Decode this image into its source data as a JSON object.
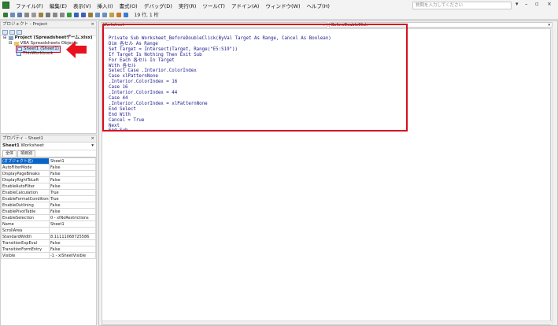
{
  "menu": {
    "items": [
      "ファイル(F)",
      "編集(E)",
      "表示(V)",
      "挿入(I)",
      "書式(O)",
      "デバッグ(D)",
      "実行(R)",
      "ツール(T)",
      "アドイン(A)",
      "ウィンドウ(W)",
      "ヘルプ(H)"
    ],
    "help_placeholder": "質問を入力してください",
    "close_glyph": "×"
  },
  "toolbar": {
    "position": "19 行, 1 桁"
  },
  "project_pane": {
    "title": "プロジェクト - Project",
    "tree": {
      "root": "Project (Spreadsheetゲーム.xlsx)",
      "folder": "VBA Spreadsheets Objects",
      "items": [
        "Sheet1 (Sheet1)",
        "ThisWorkbook"
      ]
    }
  },
  "properties_pane": {
    "title": "プロパティ - Sheet1",
    "object_name": "Sheet1",
    "object_type": "Worksheet",
    "tabs": [
      "全体",
      "項目別"
    ],
    "rows": [
      {
        "key": "(オブジェクト名)",
        "value": "Sheet1"
      },
      {
        "key": "AutoFilterMode",
        "value": "False"
      },
      {
        "key": "DisplayPageBreaks",
        "value": "False"
      },
      {
        "key": "DisplayRightToLeft",
        "value": "False"
      },
      {
        "key": "EnableAutoFilter",
        "value": "False"
      },
      {
        "key": "EnableCalculation",
        "value": "True"
      },
      {
        "key": "EnableFormatConditionsCalculation",
        "value": "True"
      },
      {
        "key": "EnableOutlining",
        "value": "False"
      },
      {
        "key": "EnablePivotTable",
        "value": "False"
      },
      {
        "key": "EnableSelection",
        "value": "0 - xlNoRestrictions"
      },
      {
        "key": "Name",
        "value": "Sheet1"
      },
      {
        "key": "ScrollArea",
        "value": ""
      },
      {
        "key": "StandardWidth",
        "value": "8.11111068725586"
      },
      {
        "key": "TransitionExpEval",
        "value": "False"
      },
      {
        "key": "TransitionFormEntry",
        "value": "False"
      },
      {
        "key": "Visible",
        "value": "-1 - xlSheetVisible"
      }
    ]
  },
  "code_window": {
    "object_combo": "Worksheet",
    "proc_combo": "BeforeDoubleClick",
    "lines": [
      "Private Sub Worksheet_BeforeDoubleClick(ByVal Target As Range, Cancel As Boolean)",
      "Dim 各セル As Range",
      "Set Target = Intersect(Target, Range(\"E5:S19\"))",
      "If Target Is Nothing Then Exit Sub",
      "For Each 各セル In Target",
      "With 各セル",
      "Select Case .Interior.ColorIndex",
      "Case xlPatternNone",
      ".Interior.ColorIndex = 16",
      "Case 16",
      ".Interior.ColorIndex = 44",
      "Case 44",
      ".Interior.ColorIndex = xlPatternNone",
      "End Select",
      "End With",
      "Cancel = True",
      "Next",
      "End Sub"
    ]
  },
  "colors": {
    "highlight": "#d80f1e",
    "code_text": "#1a1a8c",
    "selection": "#0a64c8"
  }
}
